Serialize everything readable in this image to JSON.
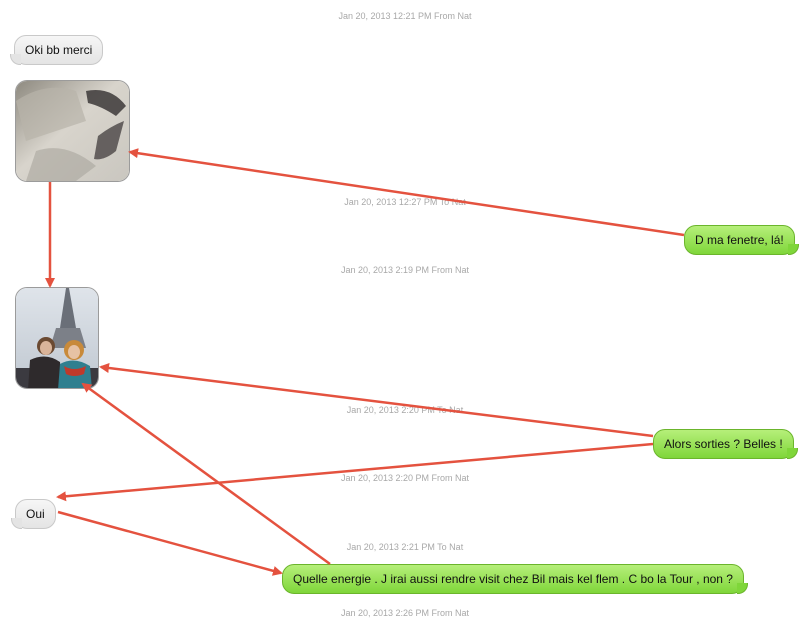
{
  "timestamps": [
    "Jan 20, 2013 12:21 PM From Nat",
    "Jan 20, 2013 12:27 PM To Nat",
    "Jan 20, 2013 2:19 PM From Nat",
    "Jan 20, 2013 2:20 PM To Nat",
    "Jan 20, 2013 2:20 PM From Nat",
    "Jan 20, 2013 2:21 PM To Nat",
    "Jan 20, 2013 2:26 PM From Nat"
  ],
  "messages": {
    "oki": "Oki bb merci",
    "fenetre": "D ma fenetre,  lá!",
    "sorties": "Alors sorties ? Belles !",
    "oui": "Oui",
    "energie": "Quelle energie . J irai aussi rendre visit chez Bil mais kel flem . C bo la Tour , non ?"
  },
  "colors": {
    "incoming_bubble": "#e8e8e8",
    "outgoing_bubble": "#8fdc45",
    "arrow": "#e4523f",
    "timestamp_text": "#a8a8a8"
  }
}
